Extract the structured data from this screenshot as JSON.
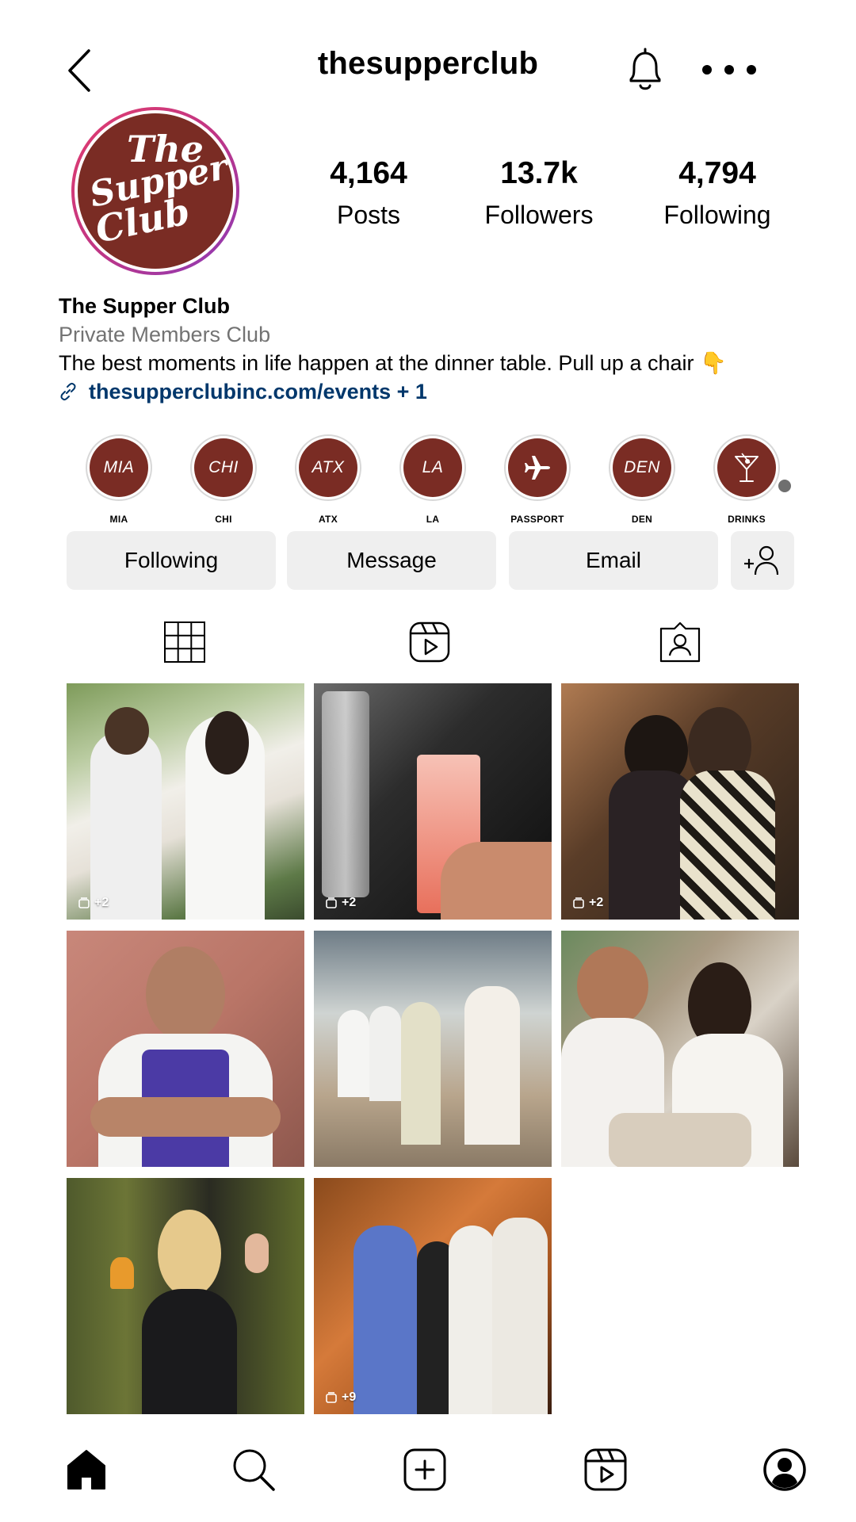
{
  "header": {
    "title": "thesupperclub"
  },
  "profile": {
    "avatar_text": [
      "The",
      "Supper",
      "Club"
    ],
    "stats": [
      {
        "value": "4,164",
        "label": "Posts"
      },
      {
        "value": "13.7k",
        "label": "Followers"
      },
      {
        "value": "4,794",
        "label": "Following"
      }
    ],
    "name": "The Supper Club",
    "category": "Private Members Club",
    "bio": "The best moments in life happen at the dinner table. Pull up a chair 👇",
    "link": "thesupperclubinc.com/events + 1"
  },
  "highlights": [
    {
      "circle": "MIA",
      "label": "MIA"
    },
    {
      "circle": "CHI",
      "label": "CHI"
    },
    {
      "circle": "ATX",
      "label": "ATX"
    },
    {
      "circle": "LA",
      "label": "LA"
    },
    {
      "circle": "plane-icon",
      "label": "PASSPORT"
    },
    {
      "circle": "DEN",
      "label": "DEN"
    },
    {
      "circle": "martini-icon",
      "label": "DRINKS"
    }
  ],
  "actions": {
    "following": "Following",
    "message": "Message",
    "email": "Email"
  },
  "posts": [
    {
      "count": "+2",
      "description": "garden party guests"
    },
    {
      "count": "+2",
      "description": "pink cocktail garnish"
    },
    {
      "count": "+2",
      "description": "two women with drinks"
    },
    {
      "count": "",
      "description": "chef in apron"
    },
    {
      "count": "",
      "description": "tennis court crowd"
    },
    {
      "count": "",
      "description": "dinner table laughter"
    },
    {
      "count": "",
      "description": "woman with cocktail"
    },
    {
      "count": "+9",
      "description": "group at bar"
    }
  ],
  "colors": {
    "brand": "#7a2c24",
    "link": "#00376b",
    "button_bg": "#efefef",
    "muted": "#737373"
  }
}
